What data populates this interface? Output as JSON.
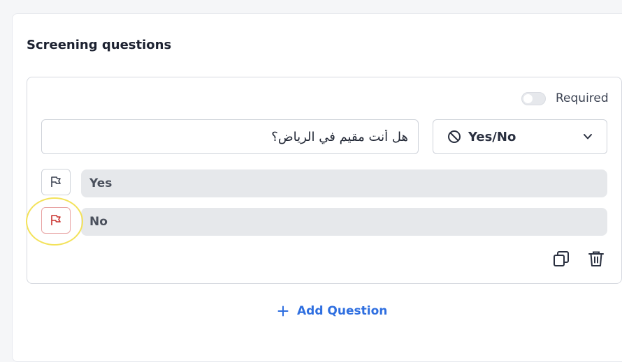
{
  "section": {
    "title": "Screening questions"
  },
  "question": {
    "required_label": "Required",
    "required": false,
    "text": "هل أنت مقيم في الرياض؟",
    "type_label": "Yes/No",
    "options": [
      {
        "label": "Yes",
        "flagged": false
      },
      {
        "label": "No",
        "flagged": true
      }
    ]
  },
  "add_question_label": "Add Question",
  "colors": {
    "accent": "#2f6fe0",
    "flag_red": "#c9302c",
    "highlight": "#f3e25a"
  },
  "icons": [
    "ban-icon",
    "chevron-down-icon",
    "flag-icon",
    "copy-icon",
    "trash-icon",
    "plus-icon"
  ]
}
